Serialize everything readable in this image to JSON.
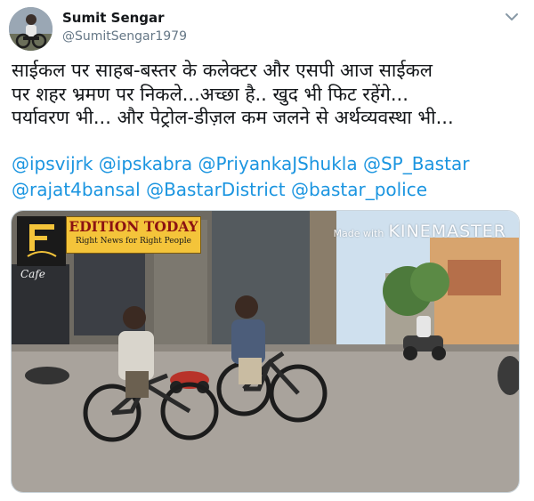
{
  "author": {
    "display_name": "Sumit Sengar",
    "handle": "@SumitSengar1979"
  },
  "tweet": {
    "lines": [
      "साईकल पर साहब-बस्तर के कलेक्टर और एसपी आज साईकल",
      "पर शहर भ्रमण पर निकले...अच्छा है.. खुद भी फिट रहेंगे...",
      "पर्यावरण भी... और पेट्रोल-डीज़ल कम जलने से अर्थव्यवस्था भी..."
    ],
    "mentions": [
      "@ipsvijrk",
      "@ipskabra",
      "@PriyankaJShukla",
      "@SP_Bastar",
      "@rajat4bansal",
      "@BastarDistrict",
      "@bastar_police"
    ]
  },
  "media": {
    "overlay_brand": "EDITION TODAY",
    "overlay_tagline": "Right News for Right People",
    "watermark_prefix": "Made with",
    "watermark_brand": "KINEMASTER",
    "storefront_sign": "Cafe"
  },
  "colors": {
    "link": "#1b95e0",
    "text": "#14171a",
    "muted": "#657786",
    "brand_bg": "#f4c43a",
    "brand_text": "#8b1212"
  }
}
